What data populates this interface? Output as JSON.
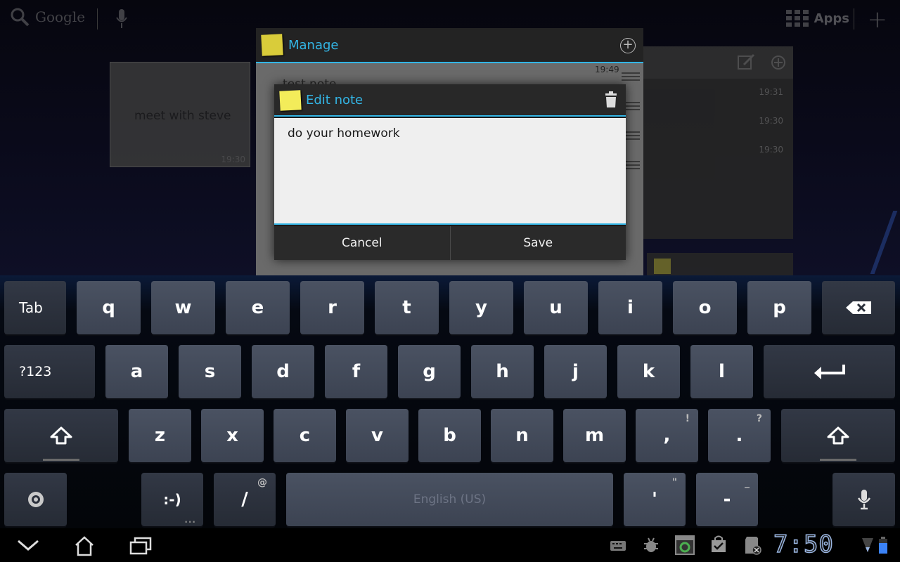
{
  "home": {
    "search_label": "Google",
    "apps_label": "Apps",
    "sticky_widget": {
      "text": "meet with steve",
      "time": "19:30"
    },
    "bg_list_times": [
      "19:31",
      "19:30",
      "19:30"
    ]
  },
  "manage": {
    "title": "Manage",
    "first_note": {
      "time": "19:49",
      "text": "test note"
    }
  },
  "dialog": {
    "title": "Edit note",
    "note_text": "do your homework",
    "cancel_label": "Cancel",
    "save_label": "Save"
  },
  "keyboard": {
    "row1": [
      "q",
      "w",
      "e",
      "r",
      "t",
      "y",
      "u",
      "i",
      "o",
      "p"
    ],
    "row2": [
      "a",
      "s",
      "d",
      "f",
      "g",
      "h",
      "j",
      "k",
      "l"
    ],
    "row3": [
      "z",
      "x",
      "c",
      "v",
      "b",
      "n",
      "m"
    ],
    "tab_label": "Tab",
    "symbols_label": "?123",
    "comma": ",",
    "comma_hint": "!",
    "period": ".",
    "period_hint": "?",
    "smiley": ":-)",
    "slash": "/",
    "slash_hint": "@",
    "space_label": "English (US)",
    "apostrophe": "'",
    "apostrophe_hint": "\"",
    "dash": "-",
    "dash_hint": "_"
  },
  "status_bar": {
    "clock": "7:50"
  },
  "colors": {
    "accent": "#33b5e5",
    "key": "#434a5a",
    "fn_key": "#2b303b"
  }
}
